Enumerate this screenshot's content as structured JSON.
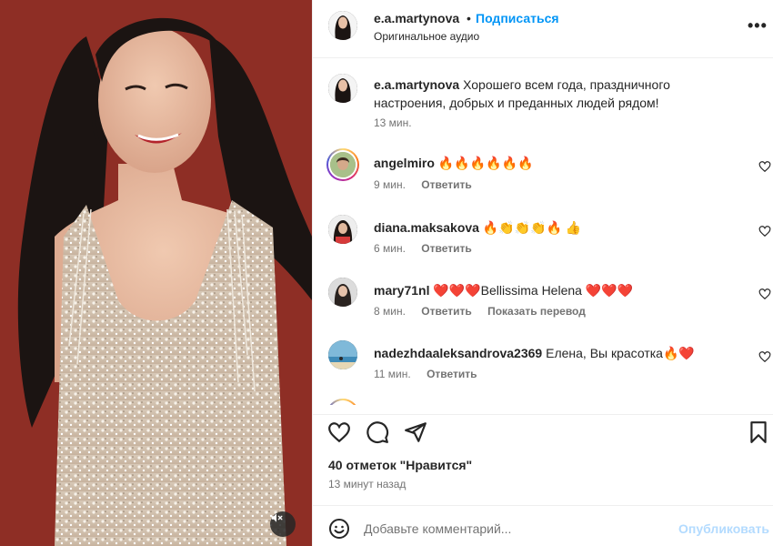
{
  "header": {
    "username": "e.a.martynova",
    "dot": "•",
    "follow_label": "Подписаться",
    "audio_label": "Оригинальное аудио",
    "more_label": "•••"
  },
  "caption": {
    "username": "e.a.martynova",
    "text": "Хорошего всем года, праздничного настроения, добрых и преданных людей рядом!",
    "time": "13 мин."
  },
  "comments": [
    {
      "username": "angelmiro",
      "text": "🔥🔥🔥🔥🔥🔥",
      "time": "9 мин.",
      "reply": "Ответить",
      "translate": ""
    },
    {
      "username": "diana.maksakova",
      "text": "🔥👏👏👏🔥 👍",
      "time": "6 мин.",
      "reply": "Ответить",
      "translate": ""
    },
    {
      "username": "mary71nl",
      "text": "❤️❤️❤️Bellissima Helena ❤️❤️❤️",
      "time": "8 мин.",
      "reply": "Ответить",
      "translate": "Показать перевод"
    },
    {
      "username": "nadezhdaaleksandrova2369",
      "text": "Елена, Вы красотка🔥❤️",
      "time": "11 мин.",
      "reply": "Ответить",
      "translate": ""
    }
  ],
  "likes_label": "40 отметок \"Нравится\"",
  "post_time": "13 минут назад",
  "composer": {
    "placeholder": "Добавьте комментарий...",
    "publish_label": "Опубликовать"
  },
  "icons": {
    "like": "heart-icon",
    "comment": "comment-icon",
    "share": "share-icon",
    "save": "bookmark-icon",
    "emoji": "emoji-icon",
    "mute": "mute-icon"
  },
  "colors": {
    "accent": "#0095f6",
    "publish_disabled": "#b3dbff",
    "secondary_text": "#737373",
    "background_red": "#8a2b23"
  }
}
